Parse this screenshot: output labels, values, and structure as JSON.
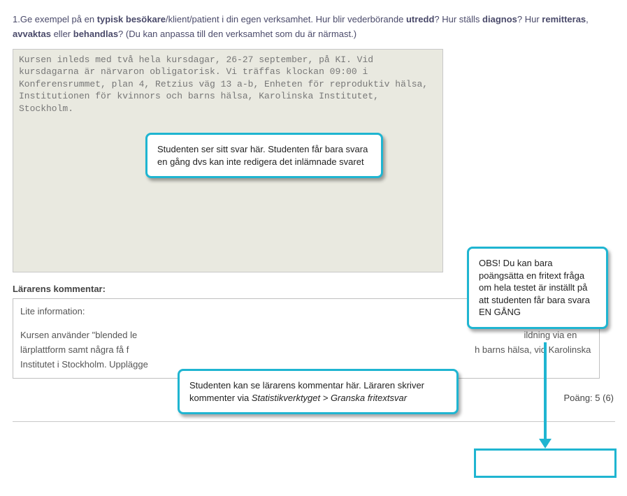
{
  "question": {
    "number": "1.",
    "parts": [
      {
        "t": "Ge exempel på en "
      },
      {
        "t": "typisk besökare",
        "b": true
      },
      {
        "t": "/klient/patient i din egen verksamhet. Hur blir vederbörande "
      },
      {
        "t": "utredd",
        "b": true
      },
      {
        "t": "? Hur ställs "
      },
      {
        "t": "diagnos",
        "b": true
      },
      {
        "t": "? Hur "
      },
      {
        "t": "remitteras",
        "b": true
      },
      {
        "t": ", "
      },
      {
        "t": "avvaktas",
        "b": true
      },
      {
        "t": " eller "
      },
      {
        "t": "behandlas",
        "b": true
      },
      {
        "t": "? (Du kan anpassa till den verksamhet som du är närmast.)"
      }
    ]
  },
  "answer": "Kursen inleds med två hela kursdagar, 26-27 september, på KI. Vid kursdagarna är närvaron obligatorisk. Vi träffas klockan 09:00 i Konferensrummet, plan 4, Retzius väg 13 a-b, Enheten för reproduktiv hälsa, Institutionen för kvinnors och barns hälsa, Karolinska Institutet, Stockholm.",
  "teacher_heading": "Lärarens kommentar:",
  "comment": {
    "title": "Lite information:",
    "body_pre": "Kursen använder \"blended le",
    "body_mid": "ildning via en lärplattform samt några få f",
    "body_post": "h barns hälsa, vid Karolinska Institutet i Stockholm. Upplägge"
  },
  "score_label": "Poäng: 5 (6)",
  "callouts": {
    "answer": "Studenten ser sitt svar här. Studenten får bara svara en gång dvs kan inte redigera det inlämnade svaret",
    "score": "OBS! Du kan bara poängsätta en fritext fråga om hela testet är inställt på att studenten får bara svara EN GÅNG",
    "comment_pre": "Studenten kan se lärarens kommentar här. Läraren skriver kommenter via ",
    "comment_italic": "Statistikverktyget > Granska fritextsvar"
  }
}
